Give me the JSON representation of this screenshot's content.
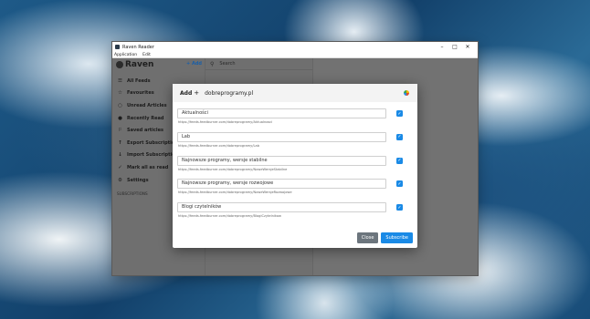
{
  "window": {
    "title": "Raven Reader",
    "menu": [
      "Application",
      "Edit"
    ]
  },
  "sidebar": {
    "logo": "Raven",
    "add_label": "+ Add",
    "items": [
      {
        "label": "All Feeds",
        "icon": "list-icon"
      },
      {
        "label": "Favourites",
        "icon": "star-icon"
      },
      {
        "label": "Unread Articles",
        "icon": "circle-icon"
      },
      {
        "label": "Recently Read",
        "icon": "dot-icon"
      },
      {
        "label": "Saved articles",
        "icon": "bookmark-icon"
      },
      {
        "label": "Export Subscriptions",
        "icon": "export-icon"
      },
      {
        "label": "Import Subscriptions",
        "icon": "import-icon"
      },
      {
        "label": "Mark all as read",
        "icon": "check-icon"
      },
      {
        "label": "Settings",
        "icon": "gear-icon"
      }
    ],
    "section_heading": "SUBSCRIPTIONS"
  },
  "search": {
    "placeholder": "Search"
  },
  "dialog": {
    "title": "Add",
    "url": "dobreprogramy.pl",
    "feeds": [
      {
        "name": "Aktualności",
        "url": "https://feeds.feedburner.com/dobreprogramy/Aktualnosci",
        "checked": true
      },
      {
        "name": "Lab",
        "url": "https://feeds.feedburner.com/dobreprogramy/Lab",
        "checked": true
      },
      {
        "name": "Najnowsze programy, wersje stabilne",
        "url": "https://feeds.feedburner.com/dobreprogramy/NoweWersjeStabilne",
        "checked": true
      },
      {
        "name": "Najnowsze programy, wersje rozwojowe",
        "url": "https://feeds.feedburner.com/dobreprogramy/NoweWersjeRozwojowe",
        "checked": true
      },
      {
        "name": "Blogi czytelników",
        "url": "https://feeds.feedburner.com/dobreprogramy/BlogiCzytelnikow",
        "checked": true
      }
    ],
    "close_label": "Close",
    "subscribe_label": "Subscribe"
  },
  "colors": {
    "accent": "#1a8ae6",
    "secondary": "#6c757d"
  }
}
